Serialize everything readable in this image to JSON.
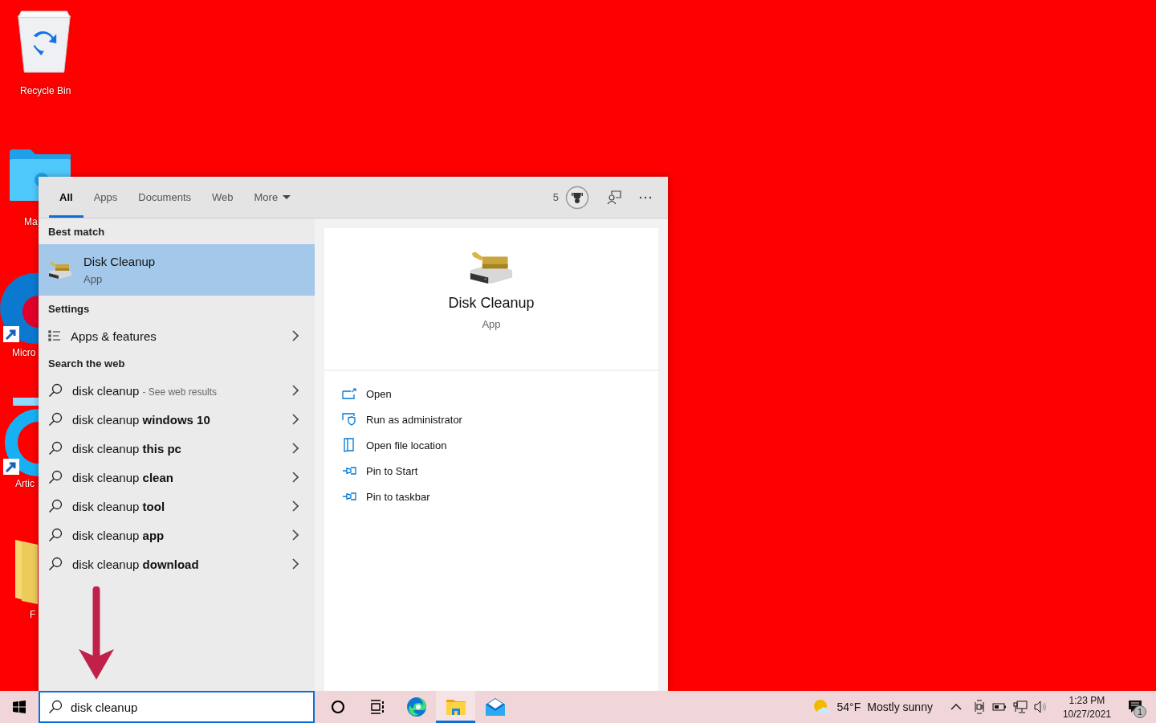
{
  "desktop_icons": [
    {
      "label": "Recycle Bin",
      "kind": "recycle"
    },
    {
      "label": "Ma",
      "kind": "folder-blue"
    },
    {
      "label": "Micro",
      "kind": "edge"
    },
    {
      "label": "Artic",
      "kind": "ring"
    },
    {
      "label": "F",
      "kind": "folder"
    }
  ],
  "search_panel": {
    "tabs": [
      {
        "label": "All",
        "selected": true
      },
      {
        "label": "Apps",
        "selected": false
      },
      {
        "label": "Documents",
        "selected": false
      },
      {
        "label": "Web",
        "selected": false
      },
      {
        "label": "More",
        "selected": false,
        "dropdown": true
      }
    ],
    "rewards_points": "5",
    "best_match": {
      "heading": "Best match",
      "title": "Disk Cleanup",
      "subtitle": "App",
      "selected": true
    },
    "settings": {
      "heading": "Settings",
      "items": [
        {
          "label": "Apps & features"
        }
      ]
    },
    "web": {
      "heading": "Search the web",
      "items": [
        {
          "text": "disk cleanup",
          "note": "- See web results"
        },
        {
          "text": "disk cleanup **windows 10**"
        },
        {
          "text": "disk cleanup **this pc**"
        },
        {
          "text": "disk cleanup **clean**"
        },
        {
          "text": "disk cleanup **tool**"
        },
        {
          "text": "disk cleanup **app**"
        },
        {
          "text": "disk cleanup **download**"
        }
      ]
    },
    "preview": {
      "title": "Disk Cleanup",
      "subtitle": "App",
      "actions": [
        {
          "label": "Open",
          "kind": "open"
        },
        {
          "label": "Run as administrator",
          "kind": "admin"
        },
        {
          "label": "Open file location",
          "kind": "location"
        },
        {
          "label": "Pin to Start",
          "kind": "pin"
        },
        {
          "label": "Pin to taskbar",
          "kind": "pin"
        }
      ]
    }
  },
  "taskbar": {
    "search": {
      "value": "disk cleanup"
    },
    "apps": [
      {
        "kind": "cortana",
        "active": false
      },
      {
        "kind": "taskview",
        "active": false
      },
      {
        "kind": "edge",
        "active": false
      },
      {
        "kind": "explorer",
        "active": true
      },
      {
        "kind": "mail",
        "active": false
      }
    ],
    "weather": {
      "temperature": "54°F",
      "condition": "Mostly sunny"
    },
    "clock": {
      "time": "1:23 PM",
      "date": "10/27/2021"
    },
    "notifications": "1"
  }
}
